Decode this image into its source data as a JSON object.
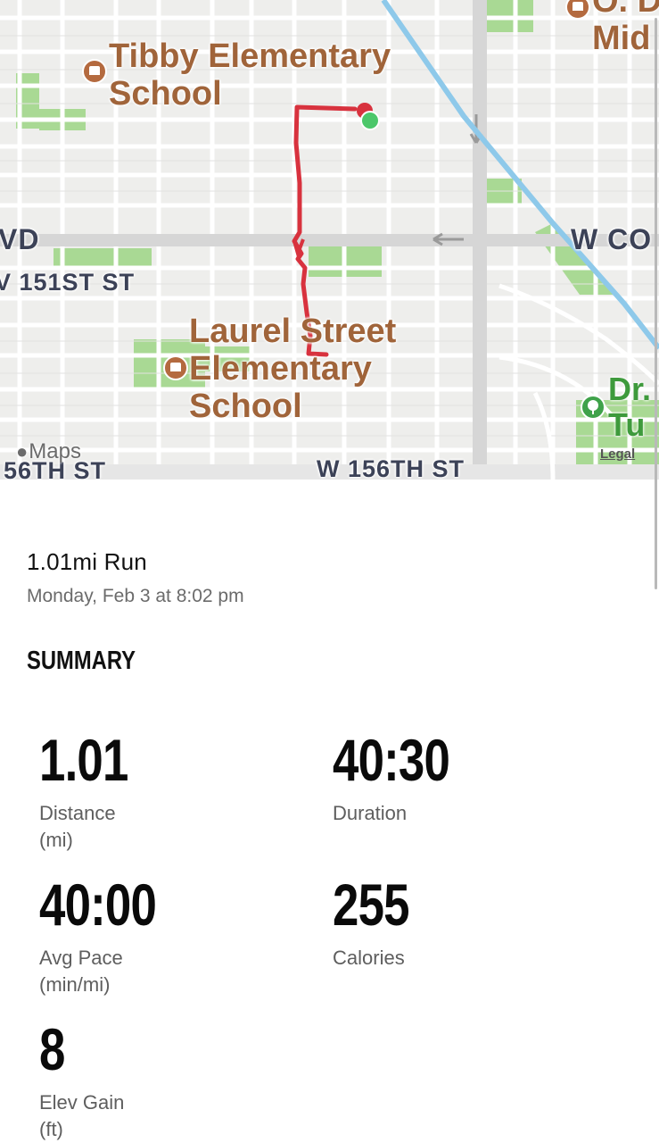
{
  "map": {
    "labels": {
      "tibby_school_line1": "Tibby Elementary",
      "tibby_school_line2": "School",
      "laurel_school_line1": "Laurel Street",
      "laurel_school_line2": "Elementary",
      "laurel_school_line3": "School",
      "od_line1": "O. D",
      "od_line2": "Mid",
      "dr_park_line1": "Dr.",
      "dr_park_line2": "Tu",
      "street_vd": "VD",
      "street_w_co": "W CO",
      "street_151st": "V 151ST ST",
      "street_56th": "56TH ST",
      "street_w_156th": "W 156TH ST"
    },
    "attribution": "Maps",
    "legal": "Legal",
    "route_color": "#d8323e",
    "start_marker_color": "#4cc76a",
    "end_marker_color": "#d8323e"
  },
  "workout": {
    "title": "1.01mi Run",
    "date": "Monday, Feb 3 at 8:02 pm"
  },
  "summary": {
    "heading": "SUMMARY",
    "stats": [
      {
        "value": "1.01",
        "label": "Distance",
        "unit": "(mi)"
      },
      {
        "value": "40:30",
        "label": "Duration",
        "unit": ""
      },
      {
        "value": "40:00",
        "label": "Avg Pace",
        "unit": "(min/mi)"
      },
      {
        "value": "255",
        "label": "Calories",
        "unit": ""
      },
      {
        "value": "8",
        "label": "Elev Gain",
        "unit": "(ft)"
      }
    ]
  }
}
